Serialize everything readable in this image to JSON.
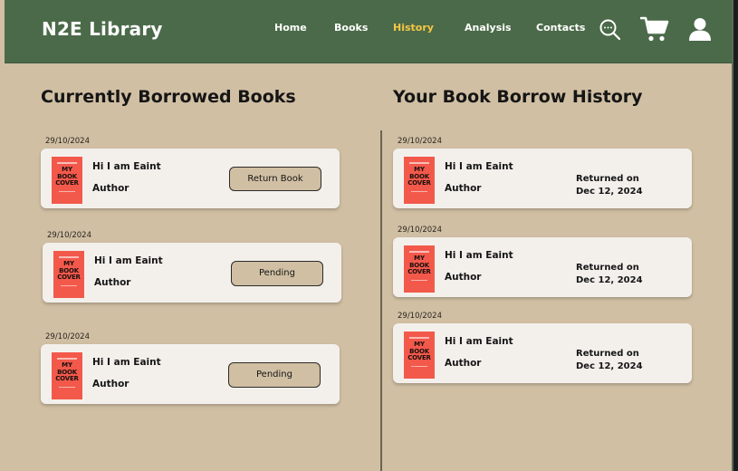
{
  "brand": "N2E Library",
  "nav": {
    "home": "Home",
    "books": "Books",
    "history": "History",
    "analysis": "Analysis",
    "contacts": "Contacts"
  },
  "icons": {
    "search": "search-icon",
    "cart": "cart-icon",
    "user": "user-icon"
  },
  "colors": {
    "header": "#4b6a49",
    "background": "#d0bfa3",
    "active_nav": "#f6c744",
    "card": "#f3f0ec",
    "cover": "#f2594b"
  },
  "cover_text": [
    "MY",
    "BOOK",
    "COVER"
  ],
  "borrowed": {
    "heading": "Currently Borrowed Books",
    "items": [
      {
        "date": "29/10/2024",
        "title": "Hi I am Eaint",
        "author": "Author",
        "action": "Return Book"
      },
      {
        "date": "29/10/2024",
        "title": "Hi I am Eaint",
        "author": "Author",
        "action": "Pending"
      },
      {
        "date": "29/10/2024",
        "title": "Hi I am Eaint",
        "author": "Author",
        "action": "Pending"
      }
    ]
  },
  "history": {
    "heading": "Your Book Borrow History",
    "items": [
      {
        "date": "29/10/2024",
        "title": "Hi I am Eaint",
        "author": "Author",
        "status": "Returned on",
        "returned_date": "Dec 12, 2024"
      },
      {
        "date": "29/10/2024",
        "title": "Hi I am Eaint",
        "author": "Author",
        "status": "Returned on",
        "returned_date": "Dec 12, 2024"
      },
      {
        "date": "29/10/2024",
        "title": "Hi I am Eaint",
        "author": "Author",
        "status": "Returned on",
        "returned_date": "Dec 12, 2024"
      }
    ]
  }
}
